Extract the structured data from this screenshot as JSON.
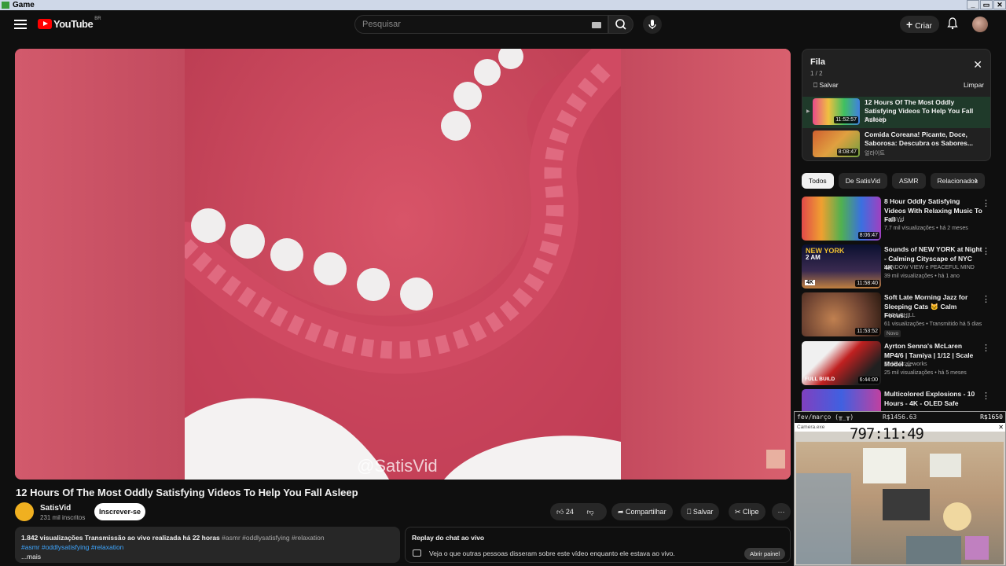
{
  "window": {
    "title": "Game",
    "controls": [
      "_",
      "▭",
      "✕"
    ]
  },
  "masthead": {
    "logo_text": "YouTube",
    "country_code": "BR",
    "search_placeholder": "Pesquisar",
    "create_label": "Criar"
  },
  "player": {
    "watermark": "@SatisVid"
  },
  "video": {
    "title": "12 Hours Of The Most Oddly Satisfying Videos To Help You Fall Asleep",
    "channel": "SatisVid",
    "subscribers": "231 mil inscritos",
    "subscribe_label": "Inscrever-se",
    "likes": "24",
    "share_label": "Compartilhar",
    "save_label": "Salvar",
    "clip_label": "Clipe",
    "more_label": "···"
  },
  "description": {
    "stats": "1.842 visualizações  Transmissão ao vivo realizada há 22 horas",
    "tags_inline": "#asmr #oddlysatisfying #relaxation",
    "tags": "#asmr #oddlysatisfying #relaxation",
    "more": "...mais"
  },
  "chat": {
    "title": "Replay do chat ao vivo",
    "message": "Veja o que outras pessoas disseram sobre este vídeo enquanto ele estava ao vivo.",
    "open_label": "Abrir painel"
  },
  "queue": {
    "title": "Fila",
    "count": "1 / 2",
    "save_label": "Salvar",
    "clear_label": "Limpar",
    "items": [
      {
        "title": "12 Hours Of The Most Oddly Satisfying Videos To Help You Fall Asleep",
        "channel": "SatisVid",
        "duration": "11:52:57"
      },
      {
        "title": "Comida Coreana! Picante, Doce, Saborosa: Descubra os Sabores...",
        "channel": "얼라이트",
        "duration": "8:08:47"
      }
    ]
  },
  "chips": [
    "Todos",
    "De SatisVid",
    "ASMR",
    "Relacionados"
  ],
  "recommendations": [
    {
      "title": "8 Hour Oddly Satisfying Videos With Relaxing Music To Fall ...",
      "channel": "SatisVid",
      "meta": "7,7 mil visualizações • há 2 meses",
      "duration": "8:06:47",
      "badge": ""
    },
    {
      "title": "Sounds of NEW YORK at Night - Calming Cityscape of NYC 4K",
      "channel": "WINDOW VIEW e PEACEFUL MIND",
      "meta": "39 mil visualizações • há 1 ano",
      "duration": "11:58:40",
      "badge": ""
    },
    {
      "title": "Soft Late Morning Jazz for Sleeping Cats 🐱 Calm Focus...",
      "channel": "YASA CHILL",
      "meta": "61 visualizações • Transmitido há 5 dias",
      "duration": "11:53:52",
      "badge": "Novo"
    },
    {
      "title": "Ayrton Senna's McLaren MP4/6 | Tamiya | 1/12 | Scale Model ...",
      "channel": "OMG Scaleworks",
      "meta": "25 mil visualizações • há 5 meses",
      "duration": "6:44:00",
      "badge": ""
    },
    {
      "title": "Multicolored Explosions - 10 Hours - 4K - OLED Safe",
      "channel": "",
      "meta": "",
      "duration": "",
      "badge": ""
    }
  ],
  "thumb_overlays": {
    "ny_text": "NEW YORK",
    "ny_time": "2 AM",
    "ny_4k": "4K",
    "senna_text": "FULL BUILD"
  },
  "overlay": {
    "bar_left": "fev/março (╥_╥)",
    "bar_mid": "R$1456.63",
    "bar_right": "R$1650",
    "window_title": "Camera.exe",
    "clock": "797:11:49"
  },
  "colors": {
    "accent_red": "#ff0000",
    "background": "#0f0f0f",
    "link_blue": "#3ea6ff"
  }
}
